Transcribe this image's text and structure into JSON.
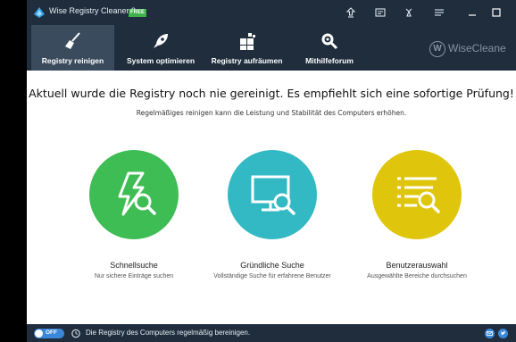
{
  "app": {
    "title": "Wise Registry Cleaner 9",
    "badge": "FREE"
  },
  "toolbar": {
    "items": [
      {
        "label": "Registry reinigen",
        "icon": "broom-icon"
      },
      {
        "label": "System optimieren",
        "icon": "rocket-icon"
      },
      {
        "label": "Registry aufräumen",
        "icon": "blocks-icon"
      },
      {
        "label": "Mithilfeforum",
        "icon": "wrench-gear-icon"
      }
    ],
    "brand": "WiseCleane",
    "brand_letter": "W"
  },
  "main": {
    "headline": "Aktuell wurde die Registry noch nie gereinigt. Es empfiehlt sich eine sofortige Prüfung!",
    "subline": "Regelmäßiges reinigen kann die Leistung und Stabilität des Computers erhöhen."
  },
  "scans": [
    {
      "title": "Schnellsuche",
      "desc": "Nur sichere Einträge suchen",
      "color": "#3ebd54",
      "icon": "lightning-search-icon"
    },
    {
      "title": "Gründliche Suche",
      "desc": "Vollständige Suche für erfahrene Benutzer",
      "color": "#33b9c4",
      "icon": "monitor-search-icon"
    },
    {
      "title": "Benutzerauswahl",
      "desc": "Ausgewählte Bereiche durchsuchen",
      "color": "#dfc60d",
      "icon": "list-search-icon"
    }
  ],
  "status": {
    "toggle": "OFF",
    "text": "Die Registry des Computers regelmäßig bereinigen."
  },
  "colors": {
    "navy": "#1f2d3d",
    "accent_blue": "#3a87d8"
  }
}
